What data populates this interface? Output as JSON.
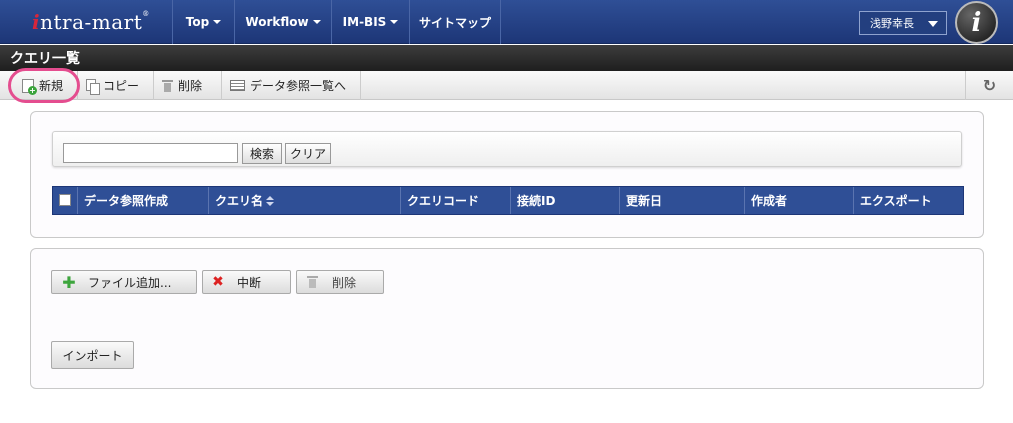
{
  "nav": {
    "logo": {
      "first_letter": "i",
      "rest": "ntra-mart",
      "reg": "®"
    },
    "items": [
      {
        "label": "Top",
        "has_dropdown": true
      },
      {
        "label": "Workflow",
        "has_dropdown": true
      },
      {
        "label": "IM-BIS",
        "has_dropdown": true
      },
      {
        "label": "サイトマップ",
        "has_dropdown": false
      }
    ],
    "user": {
      "name": "浅野幸長"
    },
    "avatar_letter": "i"
  },
  "page": {
    "title": "クエリ一覧"
  },
  "toolbar": {
    "new_label": "新規",
    "copy_label": "コピー",
    "delete_label": "削除",
    "data_ref_label": "データ参照一覧へ",
    "refresh_icon": "refresh-icon"
  },
  "search": {
    "value": "",
    "search_button": "検索",
    "clear_button": "クリア"
  },
  "grid": {
    "columns": [
      "データ参照作成",
      "クエリ名",
      "クエリコード",
      "接続ID",
      "更新日",
      "作成者",
      "エクスポート"
    ]
  },
  "import_panel": {
    "add_file_label": "ファイル追加...",
    "abort_label": "中断",
    "delete_label": "削除",
    "import_label": "インポート"
  },
  "colors": {
    "nav_bg": "#2f4f96",
    "grid_header_bg": "#2f4f96",
    "title_bg": "#2a2a2a",
    "highlight": "#e44d8f"
  }
}
